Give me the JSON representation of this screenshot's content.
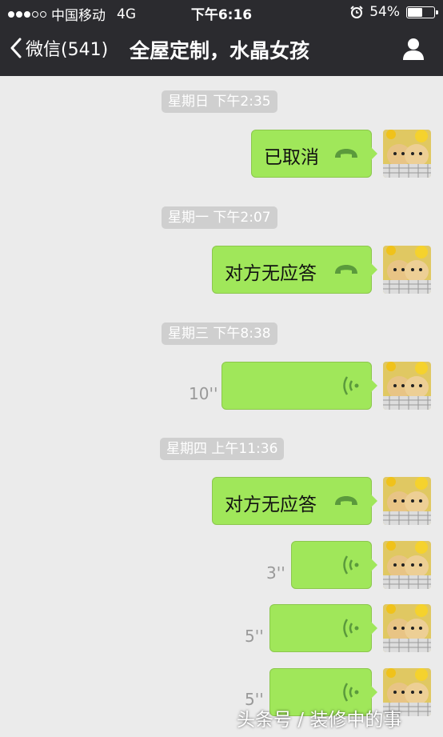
{
  "status": {
    "carrier": "中国移动",
    "network": "4G",
    "time": "下午6:16",
    "battery": "54%",
    "battery_level": 0.54
  },
  "nav": {
    "back_label": "微信(541)",
    "title": "全屋定制，水晶女孩"
  },
  "messages": [
    {
      "timestamp": "星期日 下午2:35",
      "text": "已取消",
      "type": "call"
    },
    {
      "timestamp": "星期一 下午2:07",
      "text": "对方无应答",
      "type": "call"
    },
    {
      "timestamp": "星期三 下午8:38",
      "duration": "10''",
      "type": "voice"
    },
    {
      "timestamp": "星期四 上午11:36",
      "text": "对方无应答",
      "type": "call"
    },
    {
      "duration": "3''",
      "type": "voice"
    },
    {
      "duration": "5''",
      "type": "voice"
    },
    {
      "duration": "5''",
      "type": "voice"
    }
  ],
  "watermark": "头条号 / 装修中的事",
  "colors": {
    "bar": "#2b2b2f",
    "bubble": "#a0e75a",
    "background": "#ebebeb"
  }
}
